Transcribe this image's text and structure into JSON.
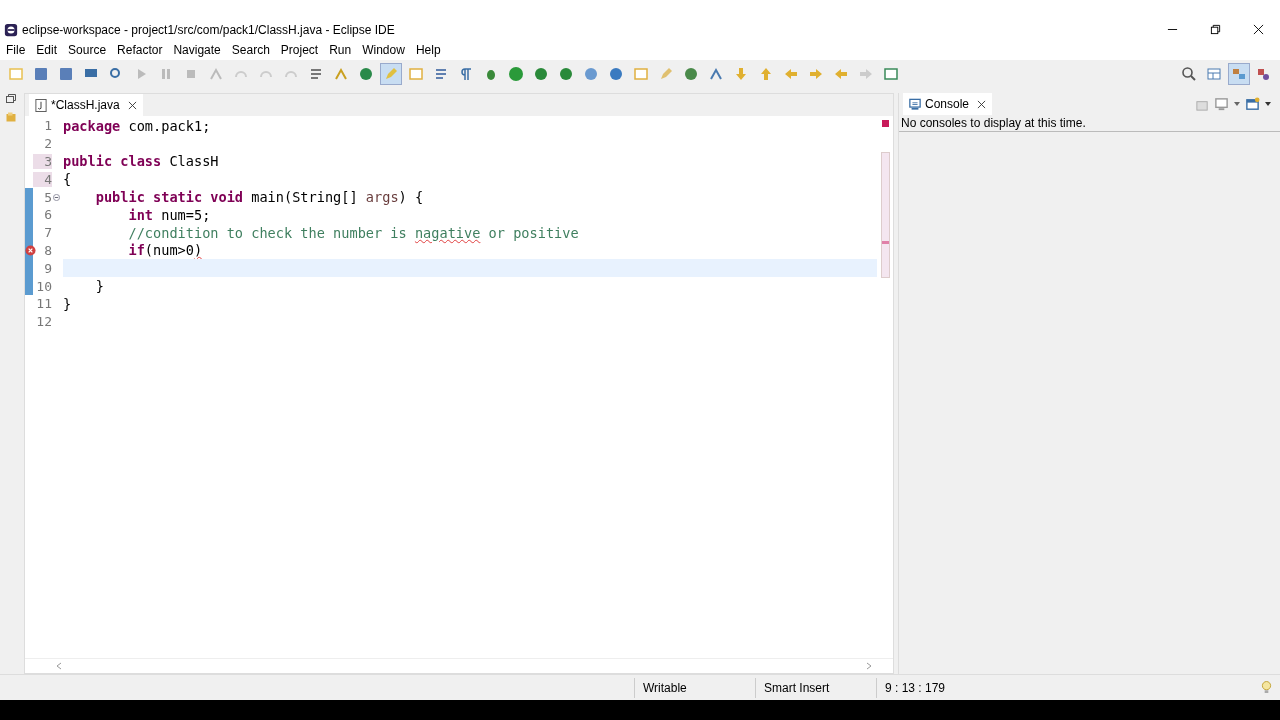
{
  "window": {
    "title": "eclipse-workspace - project1/src/com/pack1/ClassH.java - Eclipse IDE"
  },
  "menu": [
    "File",
    "Edit",
    "Source",
    "Refactor",
    "Navigate",
    "Search",
    "Project",
    "Run",
    "Window",
    "Help"
  ],
  "editor": {
    "tab": {
      "label": "*ClassH.java",
      "selected": true
    },
    "lines": [
      {
        "number": "1",
        "changed": false,
        "current": false,
        "error": false,
        "foldable": false,
        "tokens": [
          {
            "text": "package",
            "kind": "keyword"
          },
          {
            "text": " com.pack1;",
            "kind": "plain"
          }
        ]
      },
      {
        "number": "2",
        "changed": false,
        "current": false,
        "error": false,
        "foldable": false
      },
      {
        "number": "3",
        "changed": false,
        "current": false,
        "error": false,
        "foldable": false,
        "tokens": [
          {
            "text": "public class",
            "kind": "keyword"
          },
          {
            "text": " ClassH",
            "kind": "plain"
          }
        ]
      },
      {
        "number": "4",
        "changed": false,
        "current": false,
        "error": false,
        "foldable": false,
        "tokens": [
          {
            "text": "{",
            "kind": "plain"
          }
        ]
      },
      {
        "number": "5",
        "changed": true,
        "current": false,
        "error": false,
        "foldable": true,
        "tokens": [
          {
            "text": "    public static void",
            "kind": "keyword"
          },
          {
            "text": " main(String[] ",
            "kind": "plain"
          },
          {
            "text": "args",
            "kind": "param"
          },
          {
            "text": ") {",
            "kind": "plain"
          }
        ]
      },
      {
        "number": "6",
        "changed": true,
        "current": false,
        "error": false,
        "foldable": false,
        "tokens": [
          {
            "text": "        int",
            "kind": "keyword"
          },
          {
            "text": " num=5;",
            "kind": "plain"
          }
        ]
      },
      {
        "number": "7",
        "changed": true,
        "current": false,
        "error": false,
        "foldable": false,
        "tokens": [
          {
            "text": "        //condition to check the number is ",
            "kind": "comment"
          },
          {
            "text": "nagative",
            "kind": "misspelled"
          },
          {
            "text": " or positive",
            "kind": "comment"
          }
        ]
      },
      {
        "number": "8",
        "changed": true,
        "current": false,
        "error": true,
        "foldable": false,
        "tokens": [
          {
            "text": "        if",
            "kind": "keyword"
          },
          {
            "text": "(num>0",
            "kind": "plain"
          },
          {
            "text": ")",
            "kind": "error"
          }
        ]
      },
      {
        "number": "9",
        "changed": true,
        "current": true,
        "error": false,
        "foldable": false
      },
      {
        "number": "10",
        "changed": true,
        "current": false,
        "error": false,
        "foldable": false,
        "tokens": [
          {
            "text": "    }",
            "kind": "plain"
          }
        ]
      },
      {
        "number": "11",
        "changed": false,
        "current": false,
        "error": false,
        "foldable": false,
        "tokens": [
          {
            "text": "}",
            "kind": "plain"
          }
        ]
      },
      {
        "number": "12",
        "changed": false,
        "current": false,
        "error": false,
        "foldable": false
      }
    ]
  },
  "console": {
    "tab": {
      "label": "Console",
      "selected": true
    },
    "message": "No consoles to display at this time."
  },
  "status_bar": {
    "mode": "Writable",
    "insert": "Smart Insert",
    "position": "9 : 13 : 179"
  }
}
